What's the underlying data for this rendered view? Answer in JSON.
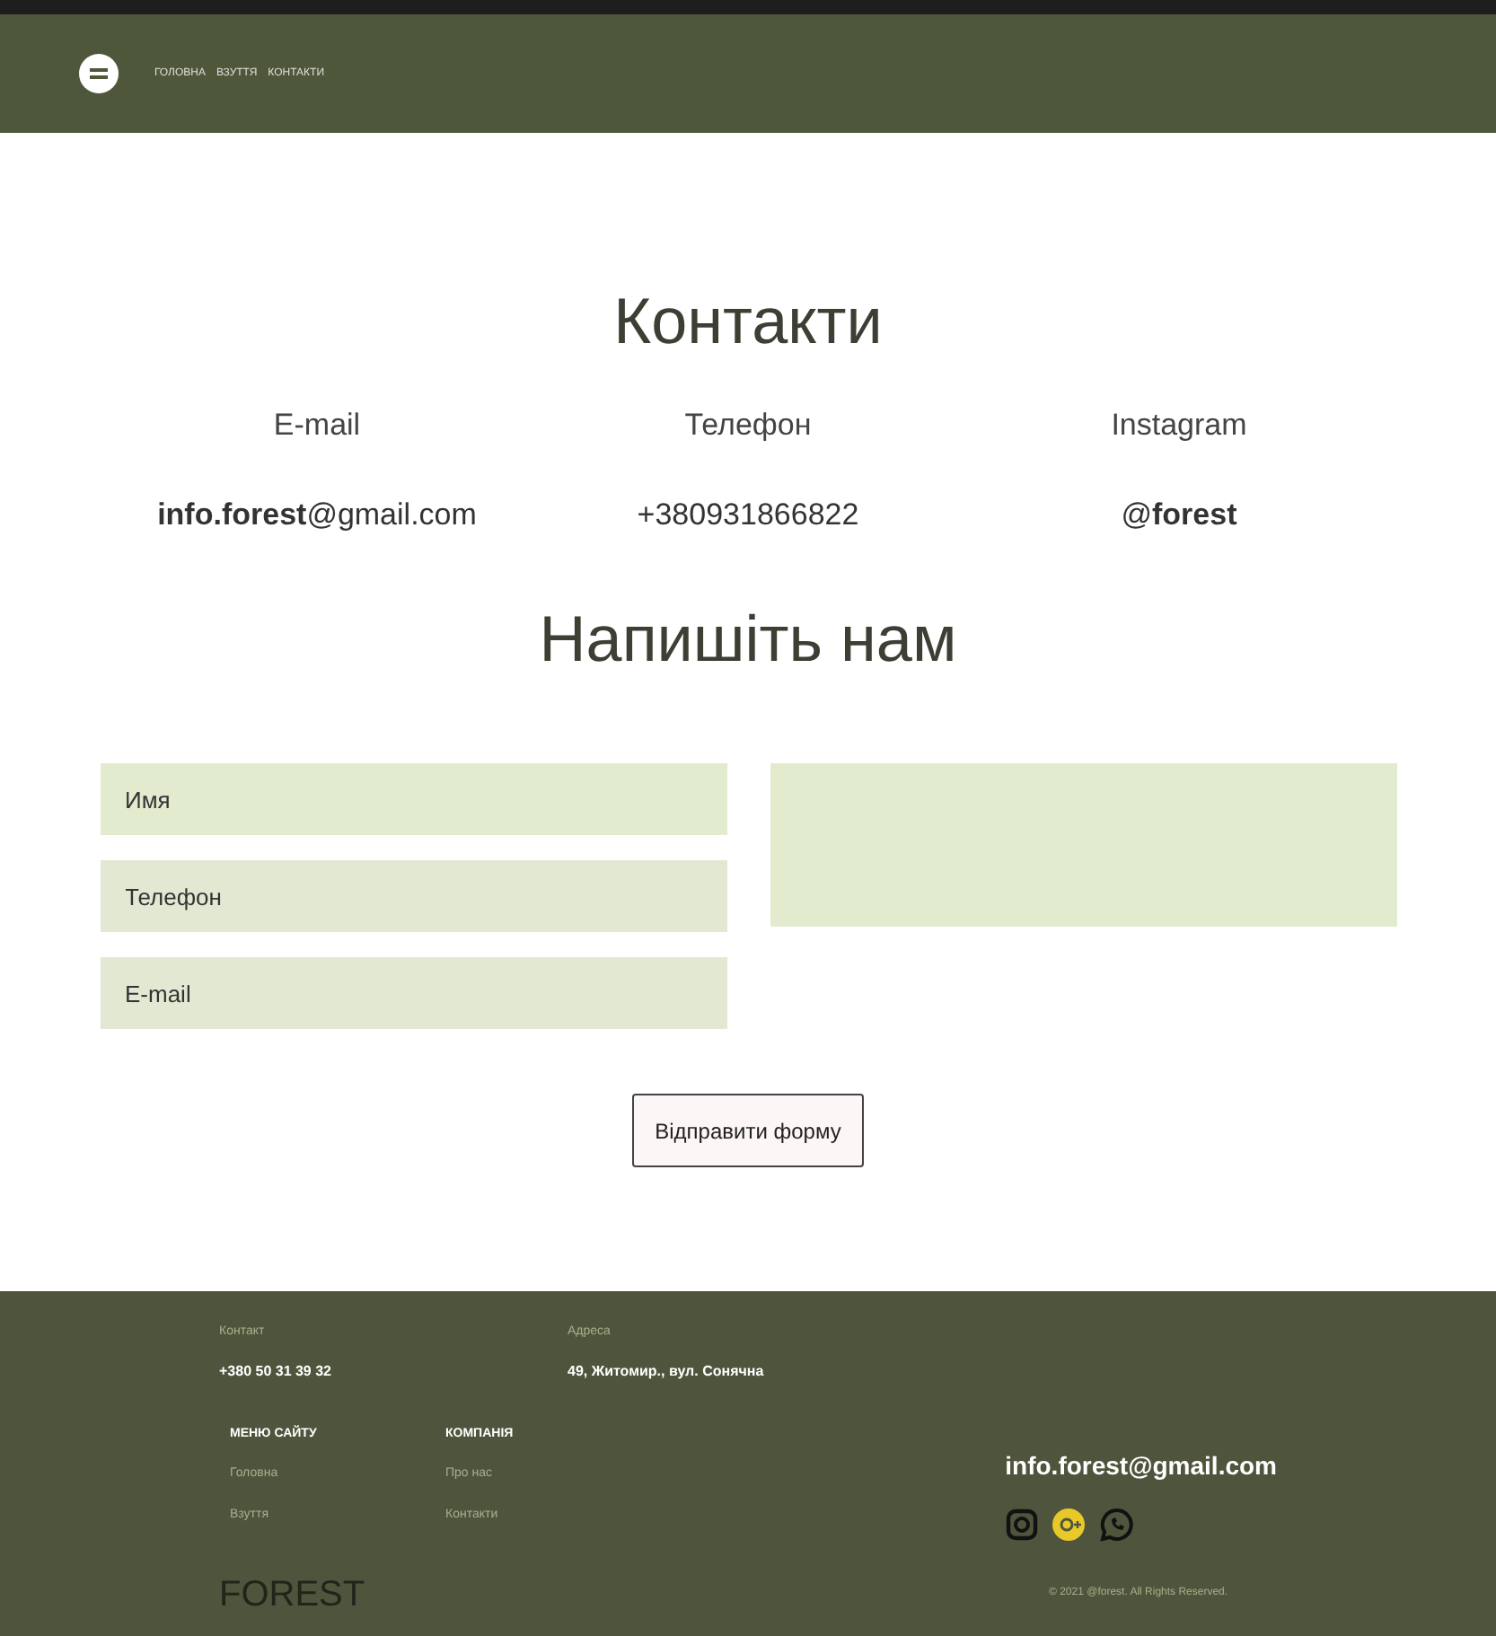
{
  "nav": {
    "links": [
      "ГОЛОВНА",
      "ВЗУТТЯ",
      "КОНТАКТИ"
    ]
  },
  "contacts": {
    "title": "Контакти",
    "items": [
      {
        "label": "E-mail",
        "value": "**info.forest**@gmail.com"
      },
      {
        "label": "Телефон",
        "value": "+380931866822"
      },
      {
        "label": "Instagram",
        "value": "@**forest**"
      }
    ]
  },
  "form": {
    "title": "Напишіть нам",
    "fields": [
      {
        "placeholder": "Имя"
      },
      {
        "placeholder": "Телефон"
      },
      {
        "placeholder": "E-mail"
      }
    ],
    "submit": "Відправити форму"
  },
  "footer": {
    "contact_label": "Контакт",
    "phone": "+380 50 31 39 32",
    "address_label": "Адреса",
    "address": "49, Житомир., вул. Сонячна",
    "menus": [
      {
        "title": "МЕНЮ САЙТУ",
        "links": [
          "Головна",
          "Взуття"
        ]
      },
      {
        "title": "КОМПАНІЯ",
        "links": [
          "Про нас",
          "Контакти"
        ]
      }
    ],
    "logo": "FOREST",
    "email": "info.forest@gmail.com",
    "copyright": "© 2021 @forest. All Rights Reserved."
  }
}
